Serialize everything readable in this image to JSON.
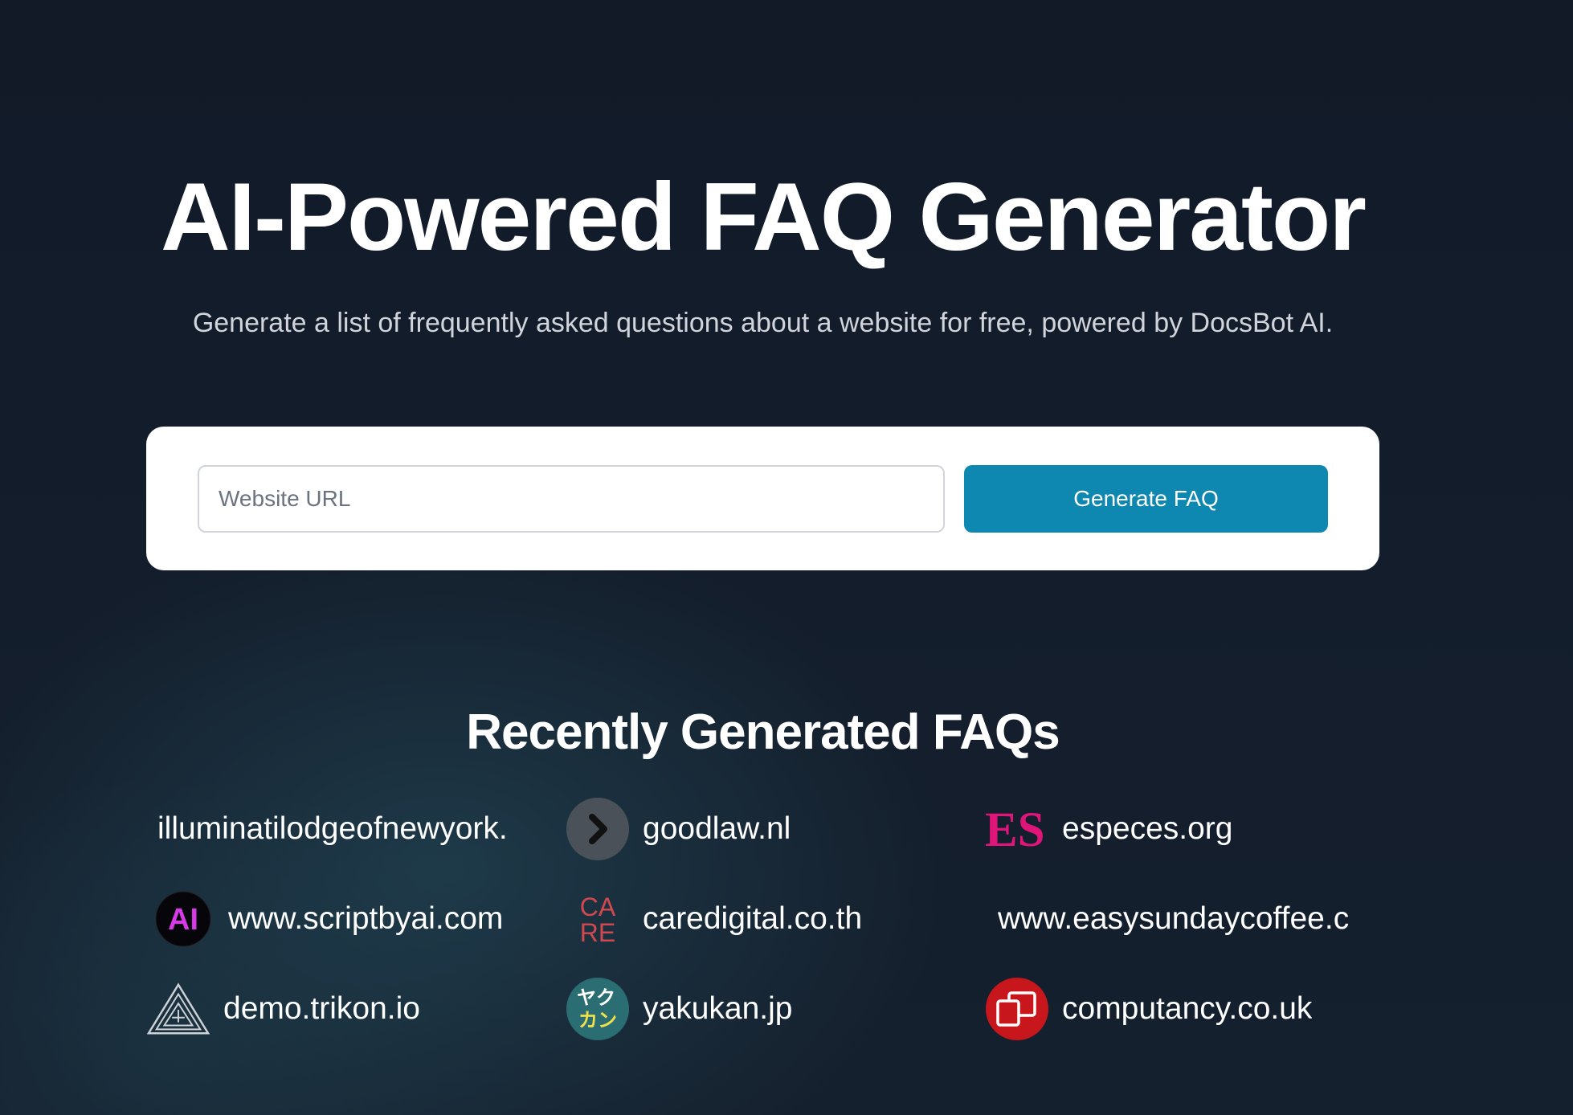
{
  "hero": {
    "title": "AI-Powered FAQ Generator",
    "subtitle": "Generate a list of frequently asked questions about a website for free, powered by DocsBot AI."
  },
  "form": {
    "url_placeholder": "Website URL",
    "url_value": "",
    "button_label": "Generate FAQ"
  },
  "recent": {
    "title": "Recently Generated FAQs",
    "items": [
      {
        "domain": "illuminatilodgeofnewyork.",
        "logo": "none"
      },
      {
        "domain": "goodlaw.nl",
        "logo": "chevron-right-icon"
      },
      {
        "domain": "especes.org",
        "logo": "es-logo"
      },
      {
        "domain": "www.scriptbyai.com",
        "logo": "ai-logo"
      },
      {
        "domain": "caredigital.co.th",
        "logo": "care-logo"
      },
      {
        "domain": "www.easysundaycoffee.c",
        "logo": "none"
      },
      {
        "domain": "demo.trikon.io",
        "logo": "triangle-maze-logo"
      },
      {
        "domain": "yakukan.jp",
        "logo": "yakukan-logo"
      },
      {
        "domain": "computancy.co.uk",
        "logo": "devices-logo"
      }
    ],
    "logo_text": {
      "es": "ES",
      "ai": "AI",
      "care_top": "CA",
      "care_bottom": "RE",
      "yakukan_top": "ヤク",
      "yakukan_bottom": "カン"
    }
  },
  "colors": {
    "background": "#111827",
    "button": "#0e87b1",
    "card": "#ffffff"
  }
}
